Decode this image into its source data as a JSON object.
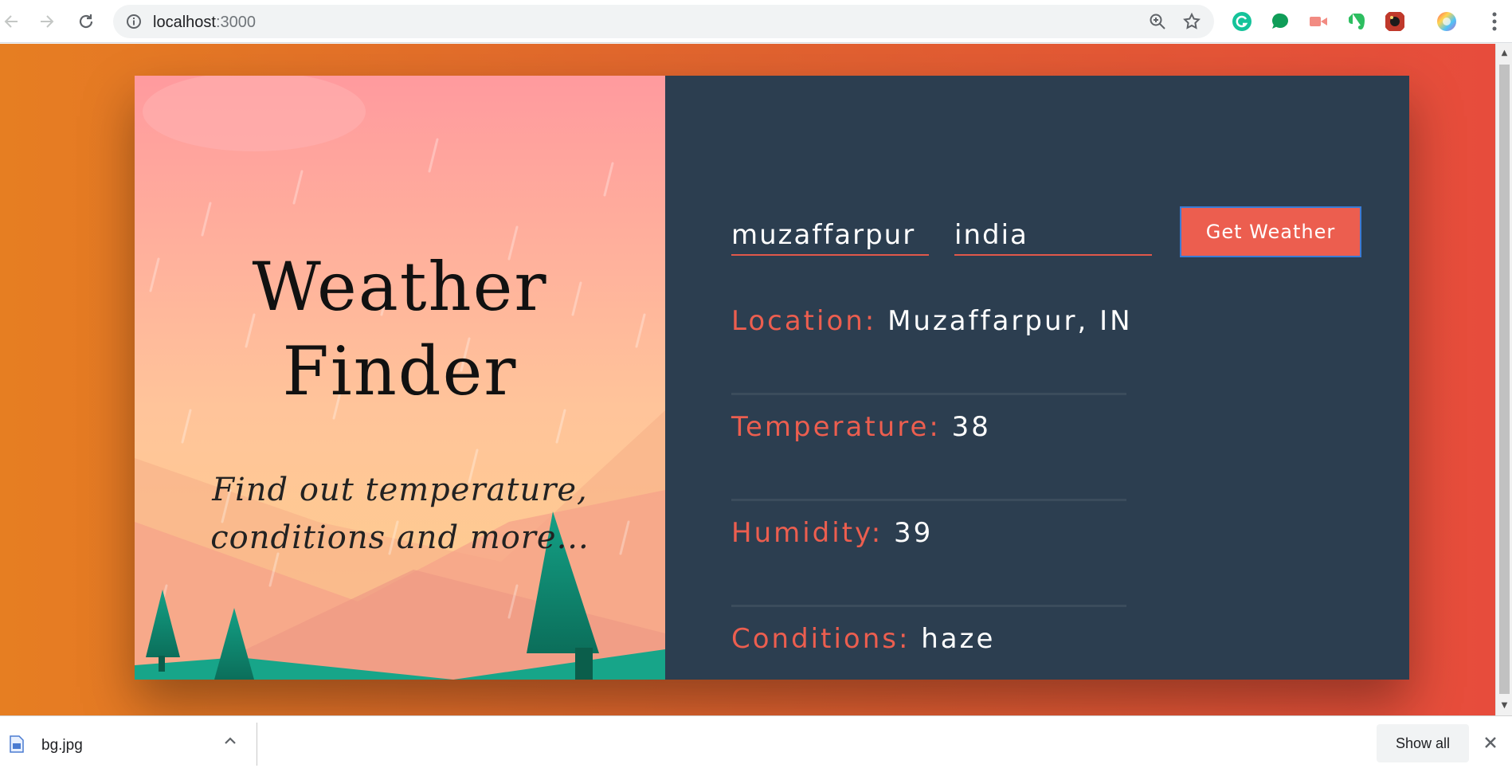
{
  "browser": {
    "back_icon": "back-arrow-icon",
    "forward_icon": "forward-arrow-icon",
    "reload_icon": "reload-icon",
    "url_host": "localhost",
    "url_port": ":3000",
    "extensions": [
      "grammarly-icon",
      "chat-extension-icon",
      "screencast-extension-icon",
      "evernote-icon",
      "web-extension-icon",
      "color-picker-icon"
    ]
  },
  "hero": {
    "title_line1": "Weather",
    "title_line2": "Finder",
    "subtitle_line1": "Find out temperature,",
    "subtitle_line2": "conditions and more..."
  },
  "form": {
    "city_value": "muzaffarpur",
    "country_value": "india",
    "button_label": "Get Weather"
  },
  "results": [
    {
      "label": "Location:",
      "value": "Muzaffarpur, IN"
    },
    {
      "label": "Temperature:",
      "value": "38"
    },
    {
      "label": "Humidity:",
      "value": "39"
    },
    {
      "label": "Conditions:",
      "value": "haze"
    }
  ],
  "downloads": {
    "file_name": "bg.jpg",
    "show_all_label": "Show all"
  },
  "colors": {
    "accent": "#ec5e4f",
    "panel": "#2c3e50",
    "page_gradient_start": "#e67e22",
    "page_gradient_end": "#e74c3c"
  }
}
